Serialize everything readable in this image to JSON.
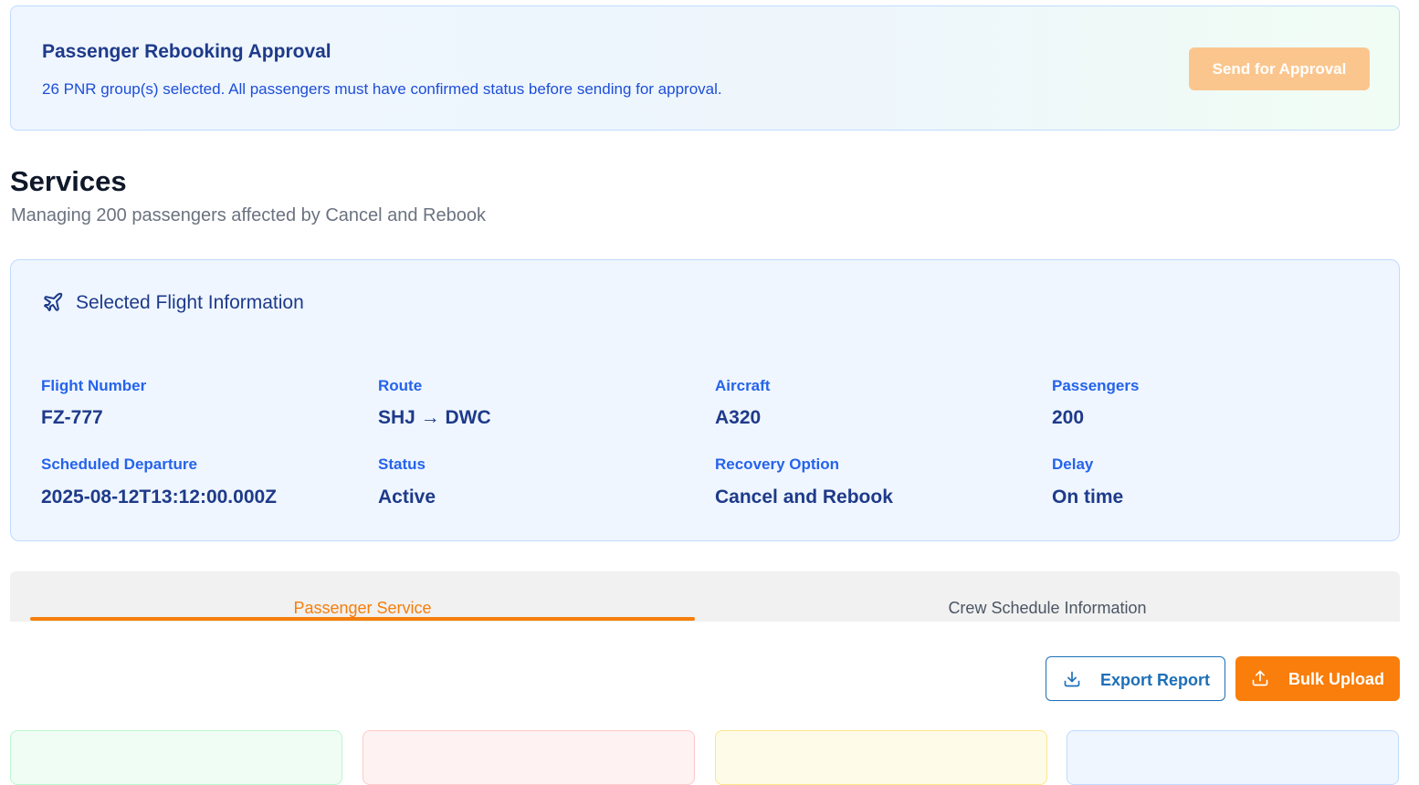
{
  "approval": {
    "title": "Passenger Rebooking Approval",
    "subtitle": "26 PNR group(s) selected. All passengers must have confirmed status before sending for approval.",
    "send_label": "Send for Approval"
  },
  "page": {
    "title": "Services",
    "subtitle": "Managing 200 passengers affected by Cancel and Rebook"
  },
  "flight": {
    "title": "Selected Flight Information",
    "fields": [
      {
        "label": "Flight Number",
        "value": "FZ-777"
      },
      {
        "label": "Route",
        "value": "SHJ → DWC"
      },
      {
        "label": "Aircraft",
        "value": "A320"
      },
      {
        "label": "Passengers",
        "value": "200"
      },
      {
        "label": "Scheduled Departure",
        "value": "2025-08-12T13:12:00.000Z"
      },
      {
        "label": "Status",
        "value": "Active"
      },
      {
        "label": "Recovery Option",
        "value": "Cancel and Rebook"
      },
      {
        "label": "Delay",
        "value": "On time"
      }
    ]
  },
  "tabs": {
    "passenger": "Passenger Service",
    "crew": "Crew Schedule Information",
    "active": "passenger"
  },
  "actions": {
    "export_label": "Export Report",
    "upload_label": "Bulk Upload"
  },
  "colors": {
    "accent": "#f97e0b",
    "primary": "#1e3a8a",
    "link": "#2563eb"
  },
  "icons": {
    "flight": "plane-icon",
    "export": "download-icon",
    "upload": "upload-icon"
  }
}
